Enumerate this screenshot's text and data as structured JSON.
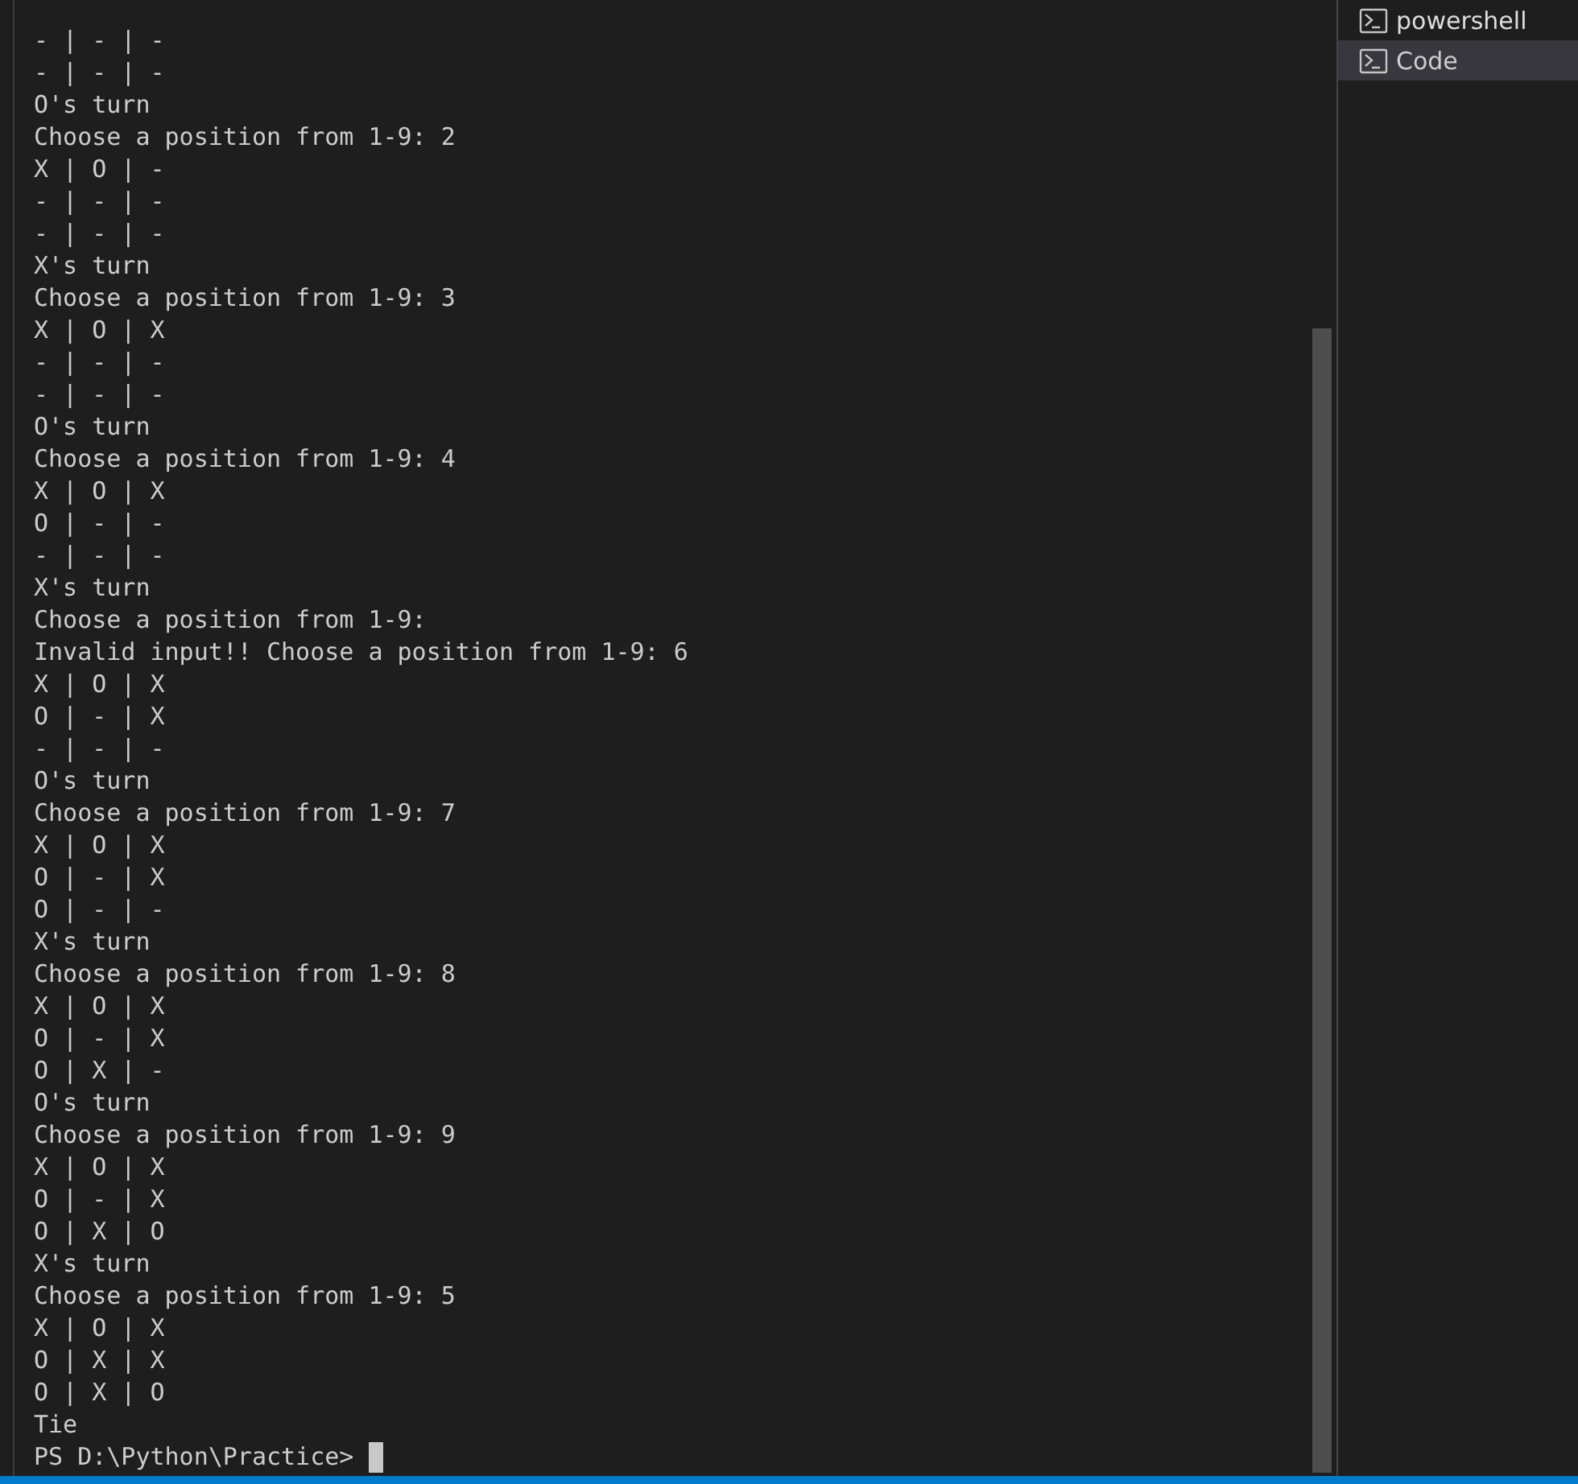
{
  "terminal": {
    "lines": [
      "- | - | -",
      "- | - | -",
      "O's turn",
      "Choose a position from 1-9: 2",
      "X | O | -",
      "- | - | -",
      "- | - | -",
      "X's turn",
      "Choose a position from 1-9: 3",
      "X | O | X",
      "- | - | -",
      "- | - | -",
      "O's turn",
      "Choose a position from 1-9: 4",
      "X | O | X",
      "O | - | -",
      "- | - | -",
      "X's turn",
      "Choose a position from 1-9:",
      "Invalid input!! Choose a position from 1-9: 6",
      "X | O | X",
      "O | - | X",
      "- | - | -",
      "O's turn",
      "Choose a position from 1-9: 7",
      "X | O | X",
      "O | - | X",
      "O | - | -",
      "X's turn",
      "Choose a position from 1-9: 8",
      "X | O | X",
      "O | - | X",
      "O | X | -",
      "O's turn",
      "Choose a position from 1-9: 9",
      "X | O | X",
      "O | - | X",
      "O | X | O",
      "X's turn",
      "Choose a position from 1-9: 5",
      "X | O | X",
      "O | X | X",
      "O | X | O",
      "Tie"
    ],
    "prompt": "PS D:\\Python\\Practice>"
  },
  "terminal_list": [
    {
      "label": "powershell",
      "selected": false
    },
    {
      "label": "Code",
      "selected": true
    }
  ]
}
